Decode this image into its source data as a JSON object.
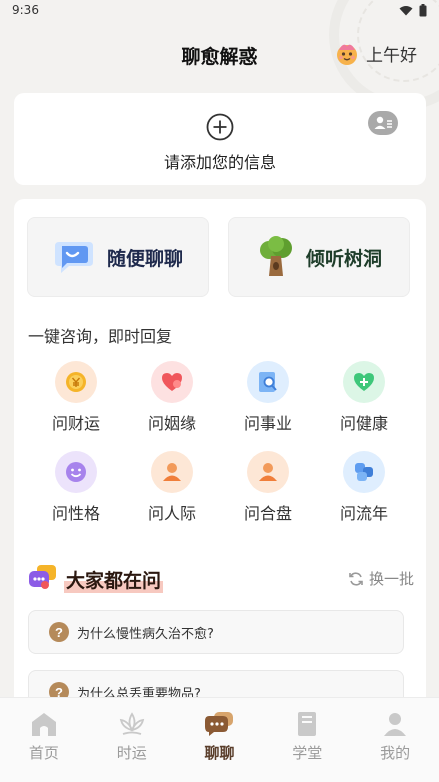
{
  "status_bar": {
    "time": "9:36"
  },
  "header": {
    "title": "聊愈解惑",
    "greeting": "上午好"
  },
  "info_card": {
    "add_label": "请添加您的信息"
  },
  "modes": [
    {
      "label": "随便聊聊"
    },
    {
      "label": "倾听树洞"
    }
  ],
  "quick_ask": {
    "heading": "一键咨询，即时回复",
    "items": [
      {
        "label": "问财运",
        "icon": "coin-icon"
      },
      {
        "label": "问姻缘",
        "icon": "heart-icon"
      },
      {
        "label": "问事业",
        "icon": "search-doc-icon"
      },
      {
        "label": "问健康",
        "icon": "health-heart-icon"
      },
      {
        "label": "问性格",
        "icon": "smile-icon"
      },
      {
        "label": "问人际",
        "icon": "person-icon"
      },
      {
        "label": "问合盘",
        "icon": "person-icon"
      },
      {
        "label": "问流年",
        "icon": "flow-icon"
      }
    ]
  },
  "popular": {
    "title": "大家都在问",
    "refresh_label": "换一批",
    "badge": "?",
    "questions": [
      "为什么慢性病久治不愈?",
      "为什么总丢重要物品?"
    ]
  },
  "bottom_nav": [
    {
      "label": "首页",
      "active": false
    },
    {
      "label": "时运",
      "active": false
    },
    {
      "label": "聊聊",
      "active": true
    },
    {
      "label": "学堂",
      "active": false
    },
    {
      "label": "我的",
      "active": false
    }
  ],
  "colors": {
    "accent": "#5a3e2b",
    "background": "#f3f2f0",
    "inactive_nav": "#9b9b9b"
  }
}
